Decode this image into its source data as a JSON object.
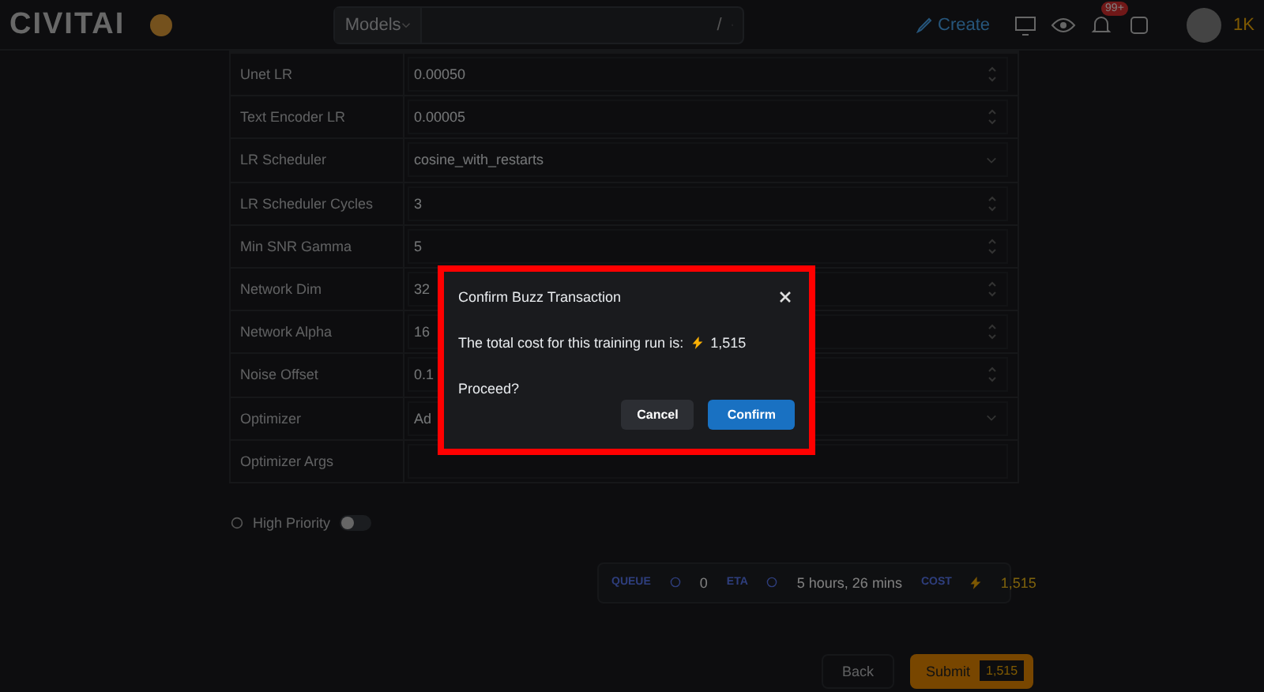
{
  "header": {
    "logo": "CIVITAI",
    "nav_select": "Models",
    "shortcut": "/",
    "create_button": "Create",
    "notification_badge": "99+",
    "buzz_balance": "1K"
  },
  "form_rows": [
    {
      "label": "Unet LR",
      "value": "0.00050",
      "kind": "number"
    },
    {
      "label": "Text Encoder LR",
      "value": "0.00005",
      "kind": "number"
    },
    {
      "label": "LR Scheduler",
      "value": "cosine_with_restarts",
      "kind": "select"
    },
    {
      "label": "LR Scheduler Cycles",
      "value": "3",
      "kind": "number"
    },
    {
      "label": "Min SNR Gamma",
      "value": "5",
      "kind": "number"
    },
    {
      "label": "Network Dim",
      "value": "32",
      "kind": "number"
    },
    {
      "label": "Network Alpha",
      "value": "16",
      "kind": "number"
    },
    {
      "label": "Noise Offset",
      "value": "0.1",
      "kind": "number"
    },
    {
      "label": "Optimizer",
      "value": "Ad",
      "kind": "select"
    },
    {
      "label": "Optimizer Args",
      "value": "",
      "kind": "text"
    }
  ],
  "high_priority": {
    "label": "High Priority",
    "on": false
  },
  "stats": [
    {
      "label": "QUEUE",
      "value": "0",
      "kind": "info"
    },
    {
      "label": "ETA",
      "value": "5 hours, 26 mins",
      "kind": "info"
    },
    {
      "label": "COST",
      "value": "1,515",
      "kind": "buzz"
    }
  ],
  "actions": {
    "back": "Back",
    "submit": "Submit",
    "submit_cost": "1,515"
  },
  "dialog": {
    "title": "Confirm Buzz Transaction",
    "message": "The total cost for this training run is:",
    "amount": "1,515",
    "question": "Proceed?",
    "cancel": "Cancel",
    "confirm": "Confirm"
  }
}
